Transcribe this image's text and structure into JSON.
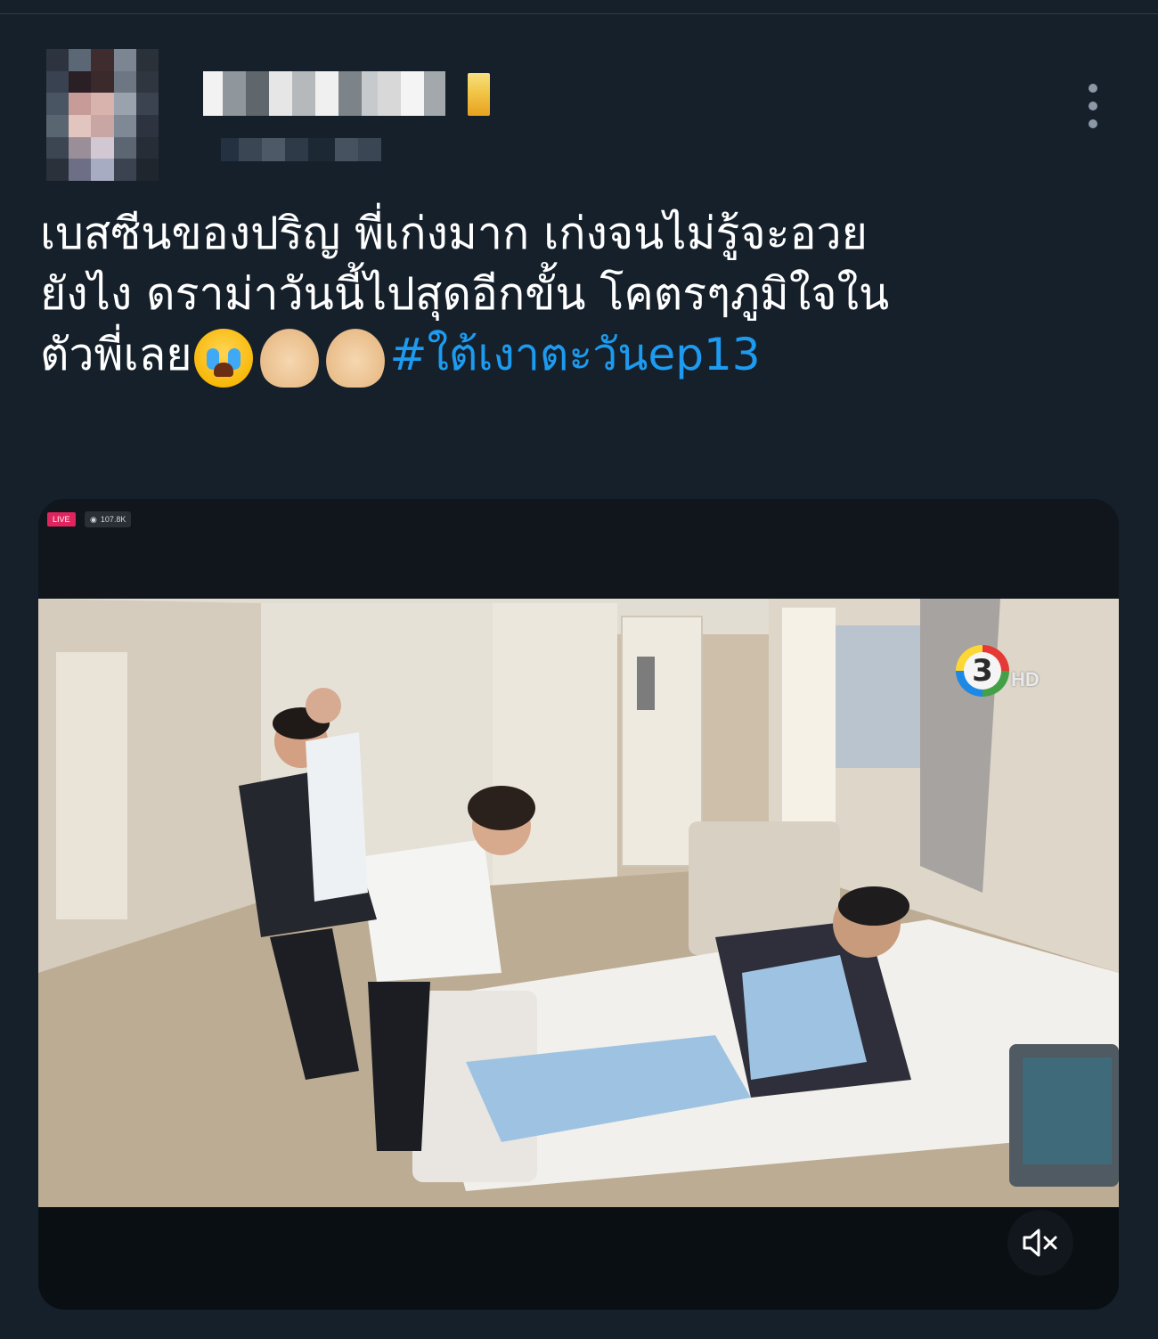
{
  "tweet": {
    "text_line_1": "เบสซีนของปริญ พี่เก่งมาก เก่งจนไม่รู้จะอวย",
    "text_line_2": "ยังไง ดราม่าวันนี้ไปสุดอีกขั้น โคตรๆภูมิใจใน",
    "text_line_3_prefix": "ตัวพี่เลย",
    "emojis": [
      "loudly-crying-face",
      "clapping-hands-light-skin",
      "clapping-hands-light-skin"
    ],
    "hashtag": "#ใต้เงาตะวันep13"
  },
  "author": {
    "avatar": "pixelated-avatar",
    "name_blurred": true,
    "handle_blurred": true,
    "verified_color": "#f2c94c"
  },
  "media": {
    "live_label": "LIVE",
    "viewer_count": "107.8K",
    "channel_logo": "3",
    "channel_hd": "HD",
    "mute_icon": "speaker-muted-icon"
  },
  "colors": {
    "background": "#15202b",
    "hashtag": "#1d9bf0",
    "text": "#ffffff"
  }
}
